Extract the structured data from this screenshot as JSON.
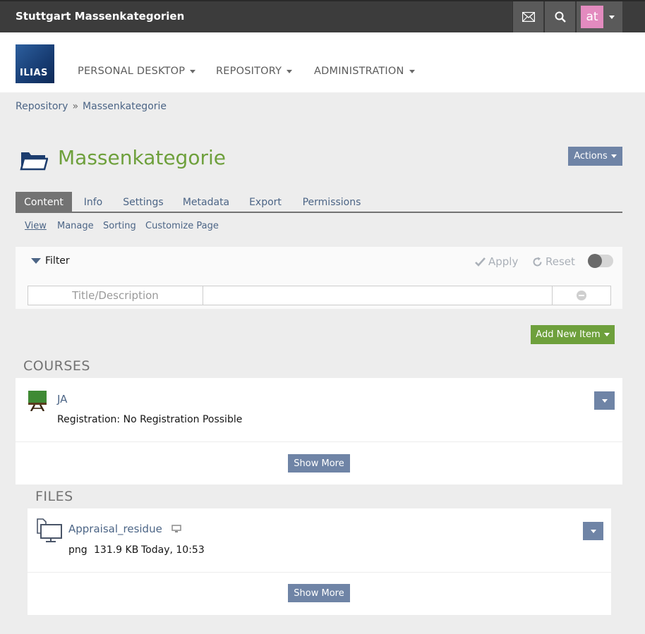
{
  "topbar": {
    "title": "Stuttgart Massenkategorien",
    "user_initials": "at",
    "avatar_color": "#e38bbf"
  },
  "logo": {
    "text": "ILIAS"
  },
  "nav": [
    {
      "label": "PERSONAL DESKTOP"
    },
    {
      "label": "REPOSITORY"
    },
    {
      "label": "ADMINISTRATION"
    }
  ],
  "breadcrumb": {
    "items": [
      "Repository",
      "Massenkategorie"
    ],
    "separator": "»"
  },
  "page": {
    "title": "Massenkategorie",
    "actions_label": "Actions",
    "title_color": "#6ea03c"
  },
  "tabs": [
    "Content",
    "Info",
    "Settings",
    "Metadata",
    "Export",
    "Permissions"
  ],
  "subtabs": [
    "View",
    "Manage",
    "Sorting",
    "Customize Page"
  ],
  "filter": {
    "toggle_label": "Filter",
    "apply_label": "Apply",
    "reset_label": "Reset",
    "field_label": "Title/Description",
    "field_value": ""
  },
  "add_new_item_label": "Add New Item",
  "courses": {
    "heading": "COURSES",
    "items": [
      {
        "title": "JA",
        "property": "Registration: No Registration Possible"
      }
    ],
    "show_more_label": "Show More"
  },
  "files": {
    "heading": "FILES",
    "items": [
      {
        "title": "Appraisal_residue",
        "type": "png",
        "size": "131.9 KB",
        "date": "Today, 10:53"
      }
    ],
    "show_more_label": "Show More"
  },
  "colors": {
    "topbar": "#3c3c3c",
    "link": "#4c6586",
    "button": "#6f84a6",
    "primary_button": "#6ea03c"
  }
}
